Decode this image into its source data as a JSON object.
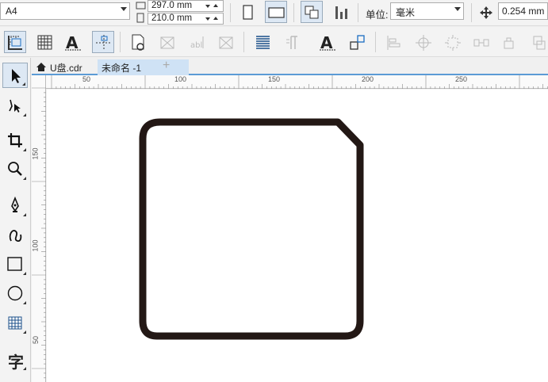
{
  "propbar": {
    "page_size": "A4",
    "width": "297.0 mm",
    "height": "210.0 mm",
    "units_label": "单位:",
    "units_value": "毫米",
    "nudge": "0.254 mm"
  },
  "tabs": [
    {
      "label": "U盘.cdr"
    },
    {
      "label": "未命名 -1"
    }
  ],
  "tab_add": "+",
  "hruler": {
    "labels": [
      {
        "text": "50"
      },
      {
        "text": "100"
      },
      {
        "text": "150"
      },
      {
        "text": "200"
      },
      {
        "text": "250"
      }
    ]
  },
  "vruler": {
    "labels": [
      {
        "text": "150"
      },
      {
        "text": "100"
      },
      {
        "text": "50"
      }
    ]
  },
  "toolbox": {
    "text_tool_glyph": "字"
  },
  "colors": {
    "shape_stroke": "#231815",
    "accent": "#5b9bd5",
    "active_tab": "#cfe2f5"
  }
}
